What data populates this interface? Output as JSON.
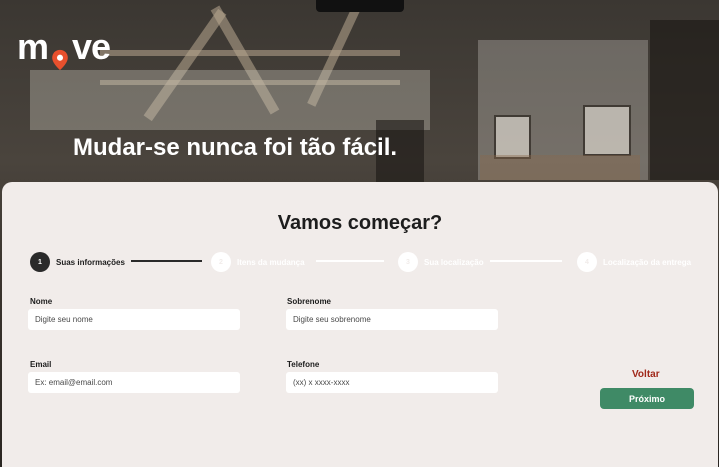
{
  "brand": {
    "logo_left": "m",
    "logo_right": "ve",
    "accent": "#e8502d"
  },
  "hero": {
    "headline": "Mudar-se nunca foi tão fácil."
  },
  "card": {
    "title": "Vamos começar?"
  },
  "steps": [
    {
      "number": "1",
      "label": "Suas informações",
      "state": "active"
    },
    {
      "number": "2",
      "label": "Itens da mudança",
      "state": "inactive"
    },
    {
      "number": "3",
      "label": "Sua localização",
      "state": "inactive"
    },
    {
      "number": "4",
      "label": "Localização da entrega",
      "state": "inactive"
    }
  ],
  "form": {
    "nome": {
      "label": "Nome",
      "placeholder": "Digite seu nome"
    },
    "sobrenome": {
      "label": "Sobrenome",
      "placeholder": "Digite seu sobrenome"
    },
    "email": {
      "label": "Email",
      "placeholder": "Ex: email@email.com"
    },
    "telefone": {
      "label": "Telefone",
      "placeholder": "(xx) x xxxx-xxxx"
    }
  },
  "actions": {
    "back_label": "Voltar",
    "next_label": "Próximo"
  },
  "colors": {
    "primary": "#3f8a66",
    "back": "#a0281a",
    "card_bg": "#f1ecea"
  }
}
